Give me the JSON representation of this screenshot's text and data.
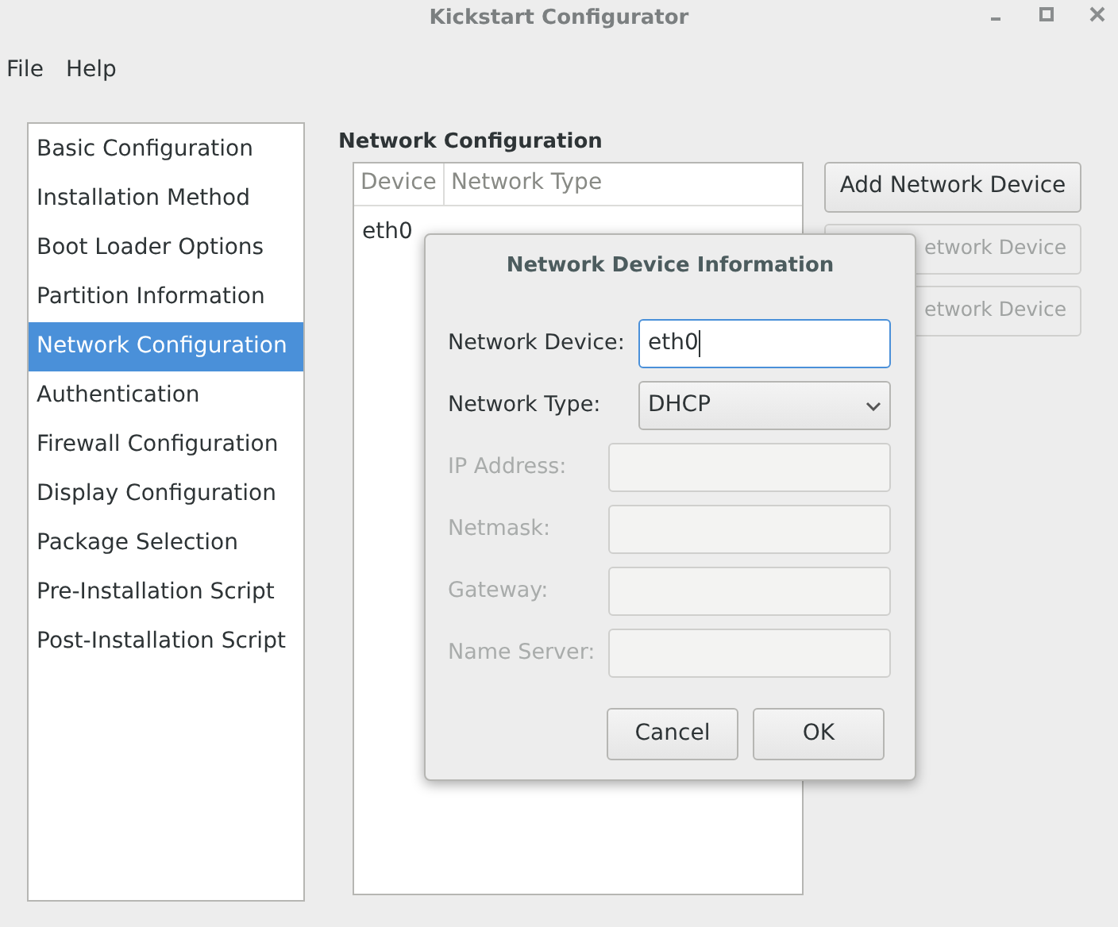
{
  "window": {
    "title": "Kickstart Configurator"
  },
  "menu": [
    "File",
    "Help"
  ],
  "sidebar": {
    "items": [
      {
        "label": "Basic Configuration",
        "selected": false
      },
      {
        "label": "Installation Method",
        "selected": false
      },
      {
        "label": "Boot Loader Options",
        "selected": false
      },
      {
        "label": "Partition Information",
        "selected": false
      },
      {
        "label": "Network Configuration",
        "selected": true
      },
      {
        "label": "Authentication",
        "selected": false
      },
      {
        "label": "Firewall Configuration",
        "selected": false
      },
      {
        "label": "Display Configuration",
        "selected": false
      },
      {
        "label": "Package Selection",
        "selected": false
      },
      {
        "label": "Pre-Installation Script",
        "selected": false
      },
      {
        "label": "Post-Installation Script",
        "selected": false
      }
    ]
  },
  "section": {
    "title": "Network Configuration"
  },
  "table": {
    "columns": [
      "Device",
      "Network Type"
    ],
    "rows": [
      [
        "eth0"
      ]
    ]
  },
  "buttons": [
    {
      "label": "Add Network Device",
      "disabled": false
    },
    {
      "label": "etwork Device",
      "disabled": true
    },
    {
      "label": "etwork Device",
      "disabled": true
    }
  ],
  "dialog": {
    "title": "Network Device Information",
    "fields": [
      {
        "kind": "text",
        "label": "Network Device:",
        "value": "eth0",
        "disabled": false,
        "focused": true
      },
      {
        "kind": "select",
        "label": "Network Type:",
        "value": "DHCP",
        "disabled": false,
        "focused": false
      },
      {
        "kind": "text",
        "label": "IP Address:",
        "disabled": true,
        "focused": false
      },
      {
        "kind": "text",
        "label": "Netmask:",
        "disabled": true,
        "focused": false
      },
      {
        "kind": "text",
        "label": "Gateway:",
        "disabled": true,
        "focused": false
      },
      {
        "kind": "text",
        "label": "Name Server:",
        "disabled": true,
        "focused": false
      }
    ],
    "buttons": [
      "Cancel",
      "OK"
    ]
  }
}
